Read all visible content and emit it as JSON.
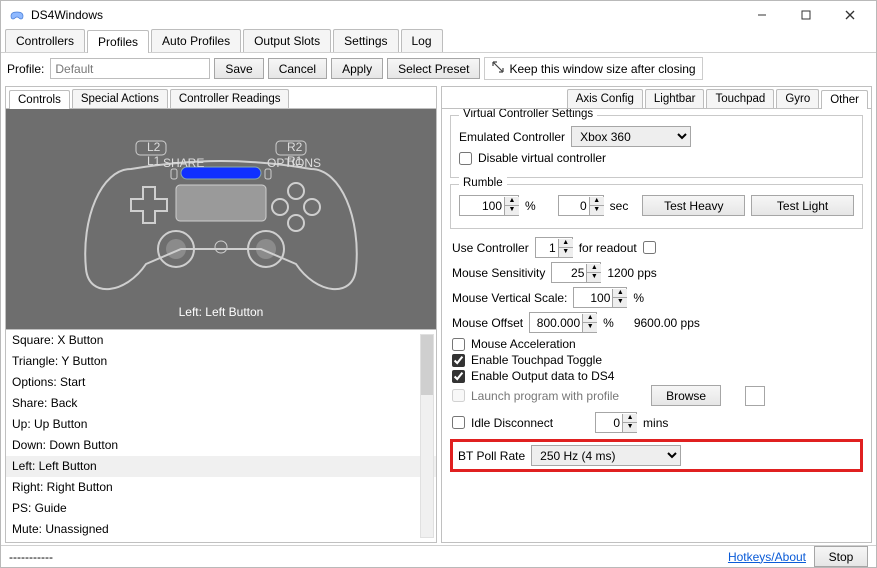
{
  "window": {
    "title": "DS4Windows"
  },
  "mainTabs": [
    "Controllers",
    "Profiles",
    "Auto Profiles",
    "Output Slots",
    "Settings",
    "Log"
  ],
  "mainTabActive": 1,
  "profileRow": {
    "label": "Profile:",
    "value": "Default",
    "save": "Save",
    "cancel": "Cancel",
    "apply": "Apply",
    "selectPreset": "Select Preset",
    "keepWindow": "Keep this window size after closing"
  },
  "leftTabs": [
    "Controls",
    "Special Actions",
    "Controller Readings"
  ],
  "leftTabActive": 0,
  "controllerCaption": "Left: Left Button",
  "mappings": [
    "Square: X Button",
    "Triangle: Y Button",
    "Options: Start",
    "Share: Back",
    "Up: Up Button",
    "Down: Down Button",
    "Left: Left Button",
    "Right: Right Button",
    "PS: Guide",
    "Mute: Unassigned"
  ],
  "mappingSelectedIndex": 6,
  "rightTabs": [
    "Axis Config",
    "Lightbar",
    "Touchpad",
    "Gyro",
    "Other"
  ],
  "rightTabActive": 4,
  "vc": {
    "legend": "Virtual Controller Settings",
    "emuLabel": "Emulated Controller",
    "emuValue": "Xbox 360",
    "disable": "Disable virtual controller"
  },
  "rumble": {
    "legend": "Rumble",
    "pct": "100",
    "pctUnit": "%",
    "sec": "0",
    "secUnit": "sec",
    "heavy": "Test Heavy",
    "light": "Test Light"
  },
  "useController": {
    "label": "Use Controller",
    "value": "1",
    "forReadout": "for readout"
  },
  "mouseSens": {
    "label": "Mouse Sensitivity",
    "value": "25",
    "pps": "1200 pps"
  },
  "mouseVert": {
    "label": "Mouse Vertical Scale:",
    "value": "100",
    "unit": "%"
  },
  "mouseOffset": {
    "label": "Mouse Offset",
    "value": "800.000",
    "unit": "%",
    "pps": "9600.00 pps"
  },
  "mouseAccel": "Mouse Acceleration",
  "touchpadToggle": "Enable Touchpad Toggle",
  "outputDS4": "Enable Output data to DS4",
  "launchProgram": "Launch program with profile",
  "browse": "Browse",
  "idleDisconnect": {
    "label": "Idle Disconnect",
    "value": "0",
    "unit": "mins"
  },
  "btPoll": {
    "label": "BT Poll Rate",
    "value": "250 Hz (4 ms)"
  },
  "status": {
    "left": "-----------",
    "hotkeys": "Hotkeys/About",
    "stop": "Stop"
  }
}
